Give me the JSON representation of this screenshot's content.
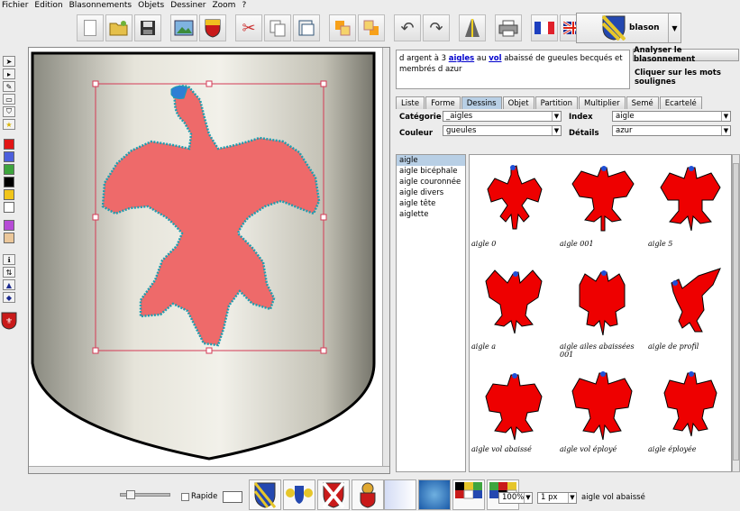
{
  "menu": [
    "Fichier",
    "Edition",
    "Blasonnements",
    "Objets",
    "Dessiner",
    "Zoom",
    "?"
  ],
  "toolbar": {
    "blason_label": "blason"
  },
  "blazon": {
    "text_before": "d argent à 3 ",
    "link1": "aigles",
    "text_mid": " au ",
    "link2": "vol",
    "text_after": " abaissé de gueules becqués et membrés d azur",
    "analyse_label": "Analyser le blasonnement",
    "hint": "Cliquer sur les mots soulignes"
  },
  "tabs": [
    "Liste",
    "Forme",
    "Dessins",
    "Objet",
    "Partition",
    "Multiplier",
    "Semé",
    "Ecartelé"
  ],
  "active_tab": "Dessins",
  "props": {
    "categorie_label": "Catégorie",
    "categorie_value": "_aigles",
    "index_label": "Index",
    "index_value": "aigle",
    "couleur_label": "Couleur",
    "couleur_value": "gueules",
    "details_label": "Détails",
    "details_value": "azur"
  },
  "symbols": [
    "aigle",
    "aigle bicéphale",
    "aigle couronnée",
    "aigle divers",
    "aigle tête",
    "aiglette"
  ],
  "selected_symbol": "aigle",
  "gallery": [
    {
      "caption": "aigle 0"
    },
    {
      "caption": "aigle 001"
    },
    {
      "caption": "aigle 5"
    },
    {
      "caption": "aigle a"
    },
    {
      "caption": "aigle ailes abaissées 001"
    },
    {
      "caption": "aigle de profil"
    },
    {
      "caption": "aigle vol abaissé"
    },
    {
      "caption": "aigle vol éployé"
    },
    {
      "caption": "aigle éployée"
    }
  ],
  "status": {
    "rapide_label": "Rapide",
    "zoom_value": "100%",
    "stroke_value": "1 px",
    "selection_text": "aigle vol abaissé"
  },
  "colors": {
    "gueules": "#ee0000",
    "eagle_fill": "#ee6a6a",
    "azur": "#1f4fd6",
    "tab_active": "#b8cfe5",
    "selection": "#d43a55"
  }
}
